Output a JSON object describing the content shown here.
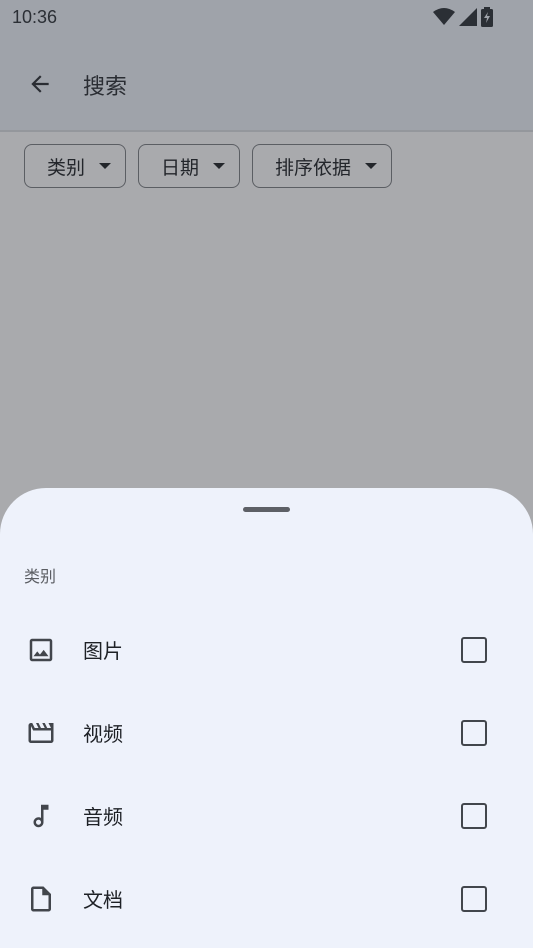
{
  "status": {
    "time": "10:36",
    "icons": [
      "wifi-icon",
      "signal-icon",
      "battery-charging-icon"
    ]
  },
  "app_bar": {
    "title": "搜索",
    "back_icon": "arrow-back-icon"
  },
  "filters": [
    {
      "label": "类别"
    },
    {
      "label": "日期"
    },
    {
      "label": "排序依据"
    }
  ],
  "sheet": {
    "title": "类别",
    "options": [
      {
        "label": "图片",
        "icon": "image-icon",
        "checked": false
      },
      {
        "label": "视频",
        "icon": "movie-icon",
        "checked": false
      },
      {
        "label": "音频",
        "icon": "music-note-icon",
        "checked": false
      },
      {
        "label": "文档",
        "icon": "document-icon",
        "checked": false
      }
    ]
  }
}
